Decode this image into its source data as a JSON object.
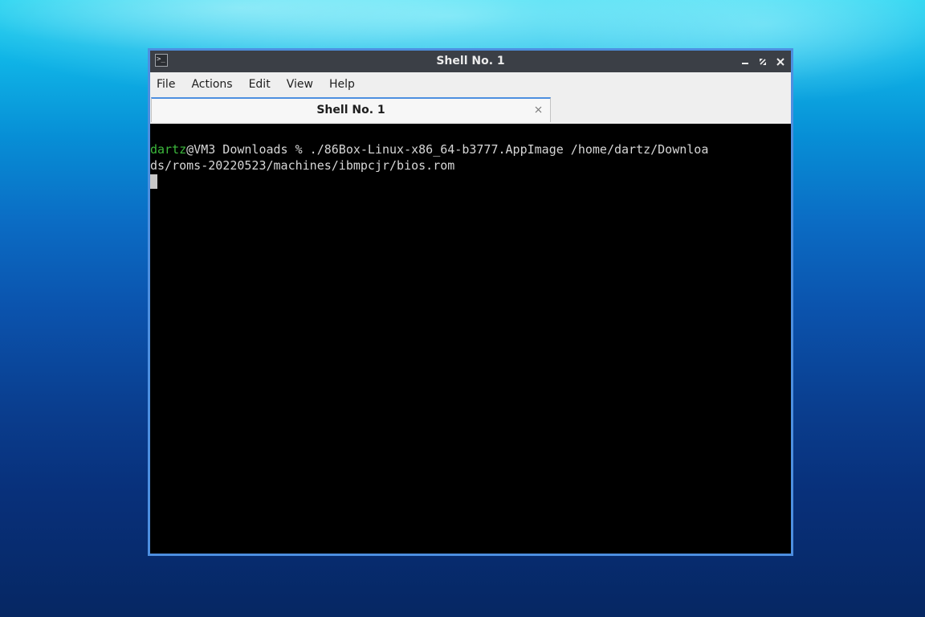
{
  "window": {
    "title": "Shell No. 1"
  },
  "menubar": {
    "items": [
      {
        "label": "File"
      },
      {
        "label": "Actions"
      },
      {
        "label": "Edit"
      },
      {
        "label": "View"
      },
      {
        "label": "Help"
      }
    ]
  },
  "tabs": [
    {
      "label": "Shell No. 1",
      "active": true
    }
  ],
  "terminal": {
    "prompt_user": "dartz",
    "line1_rest": "@VM3 Downloads % ./86Box-Linux-x86_64-b3777.AppImage /home/dartz/Downloa",
    "line2": "ds/roms-20220523/machines/ibmpcjr/bios.rom"
  },
  "icons": {
    "app": "terminal-icon",
    "minimize": "minimize-icon",
    "maximize": "maximize-icon",
    "close": "close-icon",
    "tab_close": "tab-close-icon"
  },
  "colors": {
    "accent": "#4d8fe0",
    "titlebar": "#3b3f46",
    "prompt_user": "#3cb83c",
    "terminal_bg": "#000000",
    "terminal_fg": "#d6d6d6"
  }
}
